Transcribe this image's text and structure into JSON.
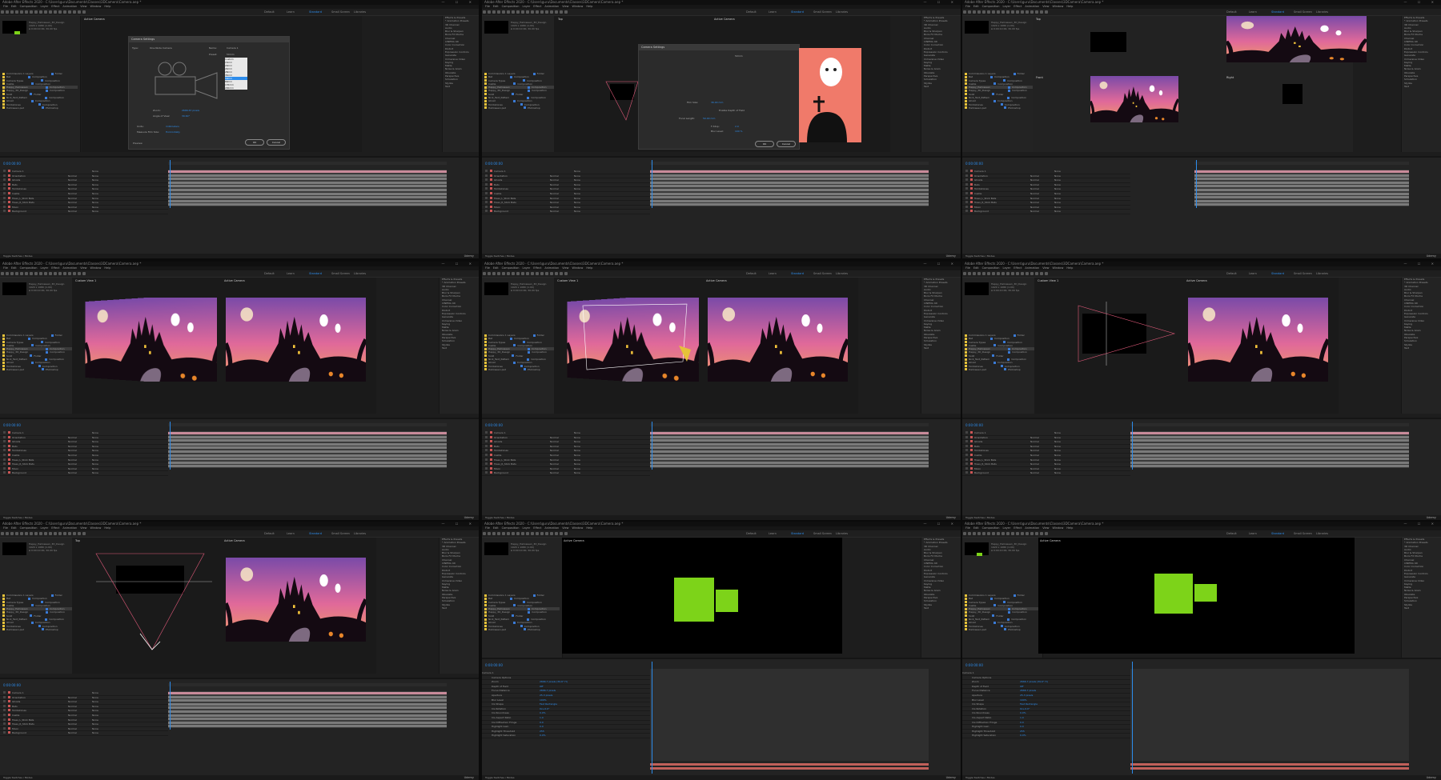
{
  "app": {
    "window_title": "Adobe After Effects 2020 - C:\\Users\\guru\\Documents\\Classes\\3DCamera\\Camera.aep *",
    "menu": [
      "File",
      "Edit",
      "Composition",
      "Layer",
      "Effect",
      "Animation",
      "View",
      "Window",
      "Help"
    ],
    "workspaces": [
      "Default",
      "Learn",
      "Standard",
      "Small Screen",
      "Libraries"
    ],
    "search_label": "Search Help",
    "status_toggle": "Toggle Switches / Modes",
    "watermark": "Udemy"
  },
  "project": {
    "comp_name": "Happy_Halloween_3D_Design",
    "comp_info": [
      "1920 x 1080 (1.00)",
      "Δ 0:00:10:00, 30.00 fps"
    ],
    "columns": [
      "Name",
      "Type",
      "Size"
    ],
    "items": [
      {
        "name": "Commissions 1 Layers",
        "type": "Folder"
      },
      {
        "name": "Bat",
        "type": "Composition"
      },
      {
        "name": "Camera Types",
        "type": "Composition"
      },
      {
        "name": "Castle",
        "type": "Composition"
      },
      {
        "name": "Happy_Halloween",
        "type": "Composition"
      },
      {
        "name": "Happy_3D_Design",
        "type": "Composition"
      },
      {
        "name": "Solid",
        "type": "Folder"
      },
      {
        "name": "Nick_Text_Pattern",
        "type": "Composition"
      },
      {
        "name": "Ghost",
        "type": "Composition"
      },
      {
        "name": "Tombstones",
        "type": "Composition"
      },
      {
        "name": "Halloween.psd",
        "type": "Photoshop"
      }
    ]
  },
  "viewers": {
    "active_camera": "Active Camera",
    "top": "Top",
    "front": "Front",
    "right": "Right",
    "left": "Left",
    "custom_view_1": "Custom View 1",
    "custom_view_2": "Custom View 2",
    "zoom": "25%",
    "quality": "Full",
    "views": "2 Views",
    "renderer": "Classic 3D"
  },
  "camera_dialog": {
    "title": "Camera Settings",
    "type_label": "Type:",
    "type_value": "One-Node Camera",
    "name_label": "Name:",
    "name_value": "Camera 1",
    "preset_label": "Preset:",
    "preset_value": "50mm",
    "presets": [
      "Custom",
      "15mm",
      "20mm",
      "24mm",
      "28mm",
      "35mm",
      "50mm",
      "80mm",
      "135mm",
      "200mm"
    ],
    "zoom_label": "Zoom:",
    "zoom_value": "2666.67 pixels",
    "angle_label": "Angle of View:",
    "angle_value": "39.60°",
    "dof_label": "Enable Depth of Field",
    "focus_label": "Focus Distance:",
    "focus_value": "2666.67 pixels",
    "aperture_label": "Aperture:",
    "aperture_value": "25.3 mm",
    "fstop_label": "F-Stop:",
    "fstop_value": "2.0",
    "blur_label": "Blur Level:",
    "blur_value": "100 %",
    "film_size_label": "Film Size:",
    "film_size_value": "36.00 mm",
    "focal_label": "Focal Length:",
    "focal_value": "50.00 mm",
    "units_label": "Units:",
    "units_value": "millimeters",
    "measure_label": "Measure Film Size:",
    "measure_value": "Horizontally",
    "comp_size": "Comp Size: 1920 px (60.0°H)",
    "preview_label": "Preview",
    "ok": "OK",
    "cancel": "Cancel"
  },
  "timeline": {
    "timecode": "0:00:00:00",
    "columns": [
      "Layer Name",
      "Mode",
      "T",
      "TrkMat",
      "Parent & Link"
    ],
    "layers": [
      {
        "num": "1",
        "name": "Camera 1",
        "mode": "",
        "parent": "None"
      },
      {
        "num": "2",
        "name": "Orientation",
        "mode": "Normal",
        "parent": "None"
      },
      {
        "num": "3",
        "name": "Ghosts",
        "mode": "Normal",
        "parent": "None"
      },
      {
        "num": "4",
        "name": "Bats",
        "mode": "Normal",
        "parent": "None"
      },
      {
        "num": "5",
        "name": "Tombstones",
        "mode": "Normal",
        "parent": "None"
      },
      {
        "num": "6",
        "name": "Castle",
        "mode": "Normal",
        "parent": "None"
      },
      {
        "num": "7",
        "name": "Trees_L_Stick Bats",
        "mode": "Normal",
        "parent": "None"
      },
      {
        "num": "8",
        "name": "Trees_R_Stick Bats",
        "mode": "Normal",
        "parent": "None"
      },
      {
        "num": "9",
        "name": "Moon",
        "mode": "Normal",
        "parent": "None"
      },
      {
        "num": "10",
        "name": "Background",
        "mode": "Normal",
        "parent": "None"
      }
    ],
    "ruler": [
      "0s",
      "01s",
      "02s",
      "03s",
      "04s",
      "05s",
      "06s",
      "07s",
      "08s",
      "09s",
      "10s"
    ],
    "modes": [
      "Normal",
      "None"
    ]
  },
  "effects_panel": {
    "title": "Effects & Presets",
    "items": [
      "* Animation Presets",
      "3D Channel",
      "Audio",
      "Blur & Sharpen",
      "Boris FX Mocha",
      "Channel",
      "CINEMA 4D",
      "Color Correction",
      "Distort",
      "Expression Controls",
      "Generate",
      "Immersive Video",
      "Keying",
      "Matte",
      "Noise & Grain",
      "Obsolete",
      "Perspective",
      "Simulation",
      "Stylize",
      "Text",
      "Time",
      "Transition",
      "Utility"
    ]
  },
  "dropdown_view": {
    "items": [
      "Active Camera",
      "Front",
      "Left",
      "Top",
      "Back",
      "Right",
      "Bottom",
      "Custom View 1",
      "Custom View 2",
      "Custom View 3"
    ]
  },
  "properties_panel": {
    "layer": "Camera 1",
    "options": [
      "Camera Options",
      "Zoom",
      "Depth of Field",
      "Focus Distance",
      "Aperture",
      "Blur Level",
      "Iris Shape",
      "Iris Rotation",
      "Iris Roundness",
      "Iris Aspect Ratio",
      "Iris Diffraction Fringe",
      "Highlight Gain",
      "Highlight Threshold",
      "Highlight Saturation"
    ],
    "values": [
      "2666.7 pixels (39.6° H)",
      "Off",
      "2666.7 pixels",
      "25.3 pixels",
      "100%",
      "Fast Rectangle",
      "0x+0.0°",
      "0.0%",
      "1.0",
      "0.0",
      "0.0",
      "255",
      "0.0%"
    ]
  },
  "colors": {
    "accent": "#2d8ceb",
    "green_shape": "#7dd319",
    "sky_top": "#7a4aa8",
    "sky_bottom": "#f0a060",
    "camera_path": "#e05a7a"
  }
}
